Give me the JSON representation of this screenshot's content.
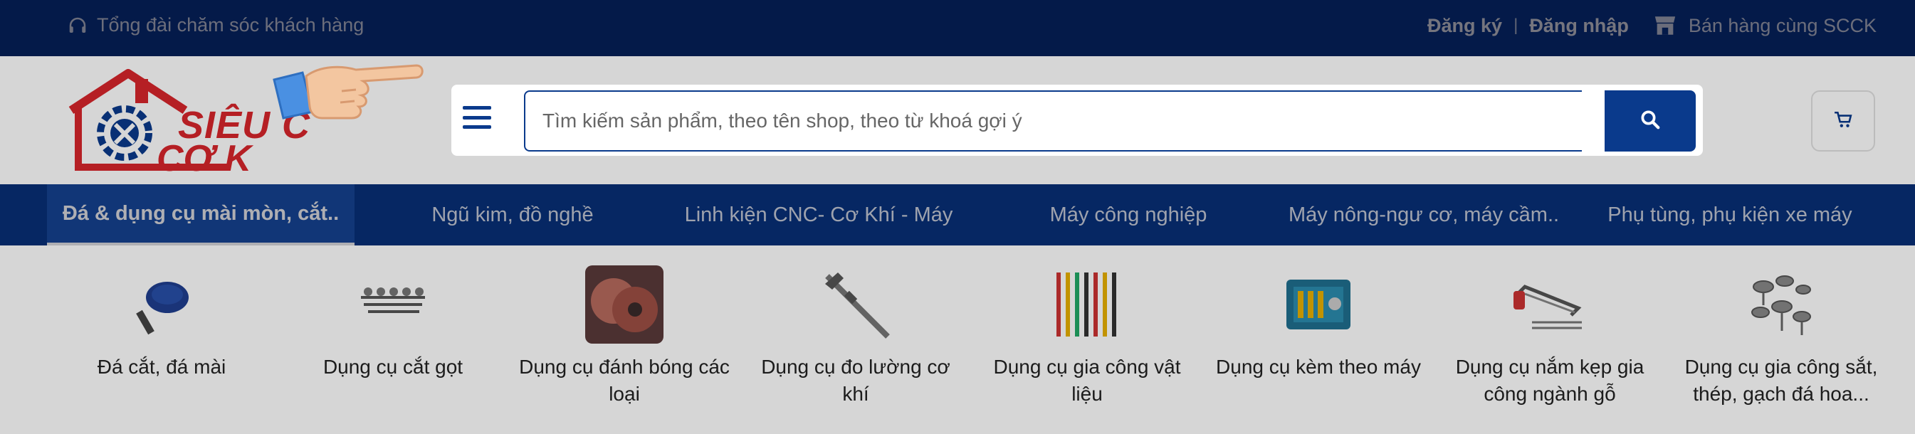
{
  "topbar": {
    "hotline_label": "Tổng đài chăm sóc khách hàng",
    "register_label": "Đăng ký",
    "separator": "|",
    "login_label": "Đăng nhập",
    "seller_label": "Bán hàng cùng SCCK"
  },
  "logo": {
    "line1": "SIÊU C",
    "line2": "CƠ K"
  },
  "search": {
    "placeholder": "Tìm kiếm sản phẩm, theo tên shop, theo từ khoá gợi ý"
  },
  "colors": {
    "brand_blue": "#0a3a8c",
    "logo_red": "#d8262c"
  },
  "categories": [
    {
      "label": "Đá & dụng cụ mài mòn, cắt..",
      "active": true
    },
    {
      "label": "Ngũ kim, đồ nghề"
    },
    {
      "label": "Linh kiện CNC- Cơ Khí - Máy"
    },
    {
      "label": "Máy công nghiệp"
    },
    {
      "label": "Máy nông-ngư cơ, máy cầm.."
    },
    {
      "label": "Phụ tùng, phụ kiện xe máy"
    }
  ],
  "subcategories": [
    {
      "label": "Đá cắt, đá mài",
      "icon": "grinding-disc-icon"
    },
    {
      "label": "Dụng cụ cắt gọt",
      "icon": "cutting-tools-icon"
    },
    {
      "label": "Dụng cụ đánh bóng các loại",
      "icon": "polishing-wheel-icon"
    },
    {
      "label": "Dụng cụ đo lường cơ khí",
      "icon": "caliper-icon"
    },
    {
      "label": "Dụng cụ gia công vật liệu",
      "icon": "screwdriver-set-icon"
    },
    {
      "label": "Dụng cụ kèm theo máy",
      "icon": "toolbox-icon"
    },
    {
      "label": "Dụng cụ nắm kẹp gia công ngành gỗ",
      "icon": "hacksaw-icon"
    },
    {
      "label": "Dụng cụ gia công sắt, thép, gạch đá hoa...",
      "icon": "hole-saw-set-icon"
    }
  ]
}
